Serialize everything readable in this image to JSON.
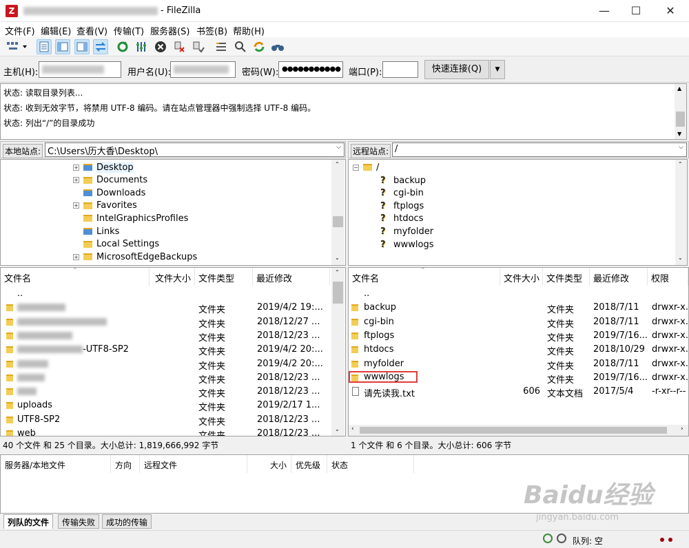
{
  "window": {
    "title_suffix": "- FileZilla",
    "icon_letter": "Z",
    "min": "—",
    "max": "☐",
    "close": "✕"
  },
  "menu": [
    "文件(F)",
    "编辑(E)",
    "查看(V)",
    "传输(T)",
    "服务器(S)",
    "书签(B)",
    "帮助(H)"
  ],
  "quickconnect": {
    "host_label": "主机(H):",
    "user_label": "用户名(U):",
    "pass_label": "密码(W):",
    "port_label": "端口(P):",
    "password_value": "●●●●●●●●●●●",
    "port_value": "",
    "button": "快速连接(Q)",
    "dropdown": "▼"
  },
  "log": [
    "状态:  读取目录列表...",
    "状态:  收到无效字节，将禁用 UTF-8 编码。请在站点管理器中强制选择 UTF-8 编码。",
    "状态:  列出“/”的目录成功"
  ],
  "local": {
    "site_label": "本地站点:",
    "path": "C:\\Users\\历大香\\Desktop\\",
    "tree": [
      {
        "name": "Desktop",
        "expand": true,
        "selected": true
      },
      {
        "name": "Documents",
        "expand": true
      },
      {
        "name": "Downloads",
        "expand": false
      },
      {
        "name": "Favorites",
        "expand": true
      },
      {
        "name": "IntelGraphicsProfiles",
        "expand": false
      },
      {
        "name": "Links",
        "expand": false
      },
      {
        "name": "Local Settings",
        "expand": false
      },
      {
        "name": "MicrosoftEdgeBackups",
        "expand": true
      }
    ],
    "columns": [
      "文件名",
      "文件大小",
      "文件类型",
      "最近修改"
    ],
    "files": [
      {
        "name": "..",
        "size": "",
        "type": "",
        "modified": "",
        "blur": 0
      },
      {
        "name": "",
        "size": "",
        "type": "文件夹",
        "modified": "2019/4/2 19:...",
        "blur": 70
      },
      {
        "name": "",
        "size": "",
        "type": "文件夹",
        "modified": "2018/12/27 ...",
        "blur": 130
      },
      {
        "name": "",
        "size": "",
        "type": "文件夹",
        "modified": "2018/12/23 ...",
        "blur": 80
      },
      {
        "name": "-UTF8-SP2",
        "size": "",
        "type": "文件夹",
        "modified": "2019/4/2 20:...",
        "blur": 95
      },
      {
        "name": "",
        "size": "",
        "type": "文件夹",
        "modified": "2019/4/2 20:...",
        "blur": 45
      },
      {
        "name": "",
        "size": "",
        "type": "文件夹",
        "modified": "2018/12/23 ...",
        "blur": 40
      },
      {
        "name": "",
        "size": "",
        "type": "文件夹",
        "modified": "2018/12/23 ...",
        "blur": 28
      },
      {
        "name": "uploads",
        "size": "",
        "type": "文件夹",
        "modified": "2019/2/17 1...",
        "blur": 0
      },
      {
        "name": "UTF8-SP2",
        "size": "",
        "type": "文件夹",
        "modified": "2018/12/23 ...",
        "blur": 0
      },
      {
        "name": "web",
        "size": "",
        "type": "文件夹",
        "modified": "2018/12/23 ...",
        "blur": 0
      }
    ],
    "status": "40 个文件 和 25 个目录。大小总计: 1,819,666,992 字节"
  },
  "remote": {
    "site_label": "远程站点:",
    "path": "/",
    "tree_root": "/",
    "tree": [
      "backup",
      "cgi-bin",
      "ftplogs",
      "htdocs",
      "myfolder",
      "wwwlogs"
    ],
    "columns": [
      "文件名",
      "文件大小",
      "文件类型",
      "最近修改",
      "权限"
    ],
    "files": [
      {
        "name": "..",
        "size": "",
        "type": "",
        "modified": "",
        "perm": "",
        "icon": "none"
      },
      {
        "name": "backup",
        "size": "",
        "type": "文件夹",
        "modified": "2018/7/11",
        "perm": "drwxr-x...",
        "icon": "folder"
      },
      {
        "name": "cgi-bin",
        "size": "",
        "type": "文件夹",
        "modified": "2018/7/11",
        "perm": "drwxr-x...",
        "icon": "folder"
      },
      {
        "name": "ftplogs",
        "size": "",
        "type": "文件夹",
        "modified": "2019/7/16...",
        "perm": "drwxr-x...",
        "icon": "folder"
      },
      {
        "name": "htdocs",
        "size": "",
        "type": "文件夹",
        "modified": "2018/10/29",
        "perm": "drwxr-x...",
        "icon": "folder"
      },
      {
        "name": "myfolder",
        "size": "",
        "type": "文件夹",
        "modified": "2018/7/11",
        "perm": "drwxr-x...",
        "icon": "folder"
      },
      {
        "name": "wwwlogs",
        "size": "",
        "type": "文件夹",
        "modified": "2019/7/16...",
        "perm": "drwxr-x...",
        "icon": "folder"
      },
      {
        "name": "请先读我.txt",
        "size": "606",
        "type": "文本文档",
        "modified": "2017/5/4",
        "perm": "-r-xr--r--",
        "icon": "file"
      }
    ],
    "status": "1 个文件 和 6 个目录。大小总计: 606 字节"
  },
  "queue": {
    "columns": [
      "服务器/本地文件",
      "方向",
      "远程文件",
      "大小",
      "优先级",
      "状态"
    ],
    "tabs": [
      "列队的文件",
      "传输失败",
      "成功的传输"
    ],
    "status": "队列: 空"
  },
  "watermark": {
    "logo": "Baidu经验",
    "url": "jingyan.baidu.com"
  }
}
